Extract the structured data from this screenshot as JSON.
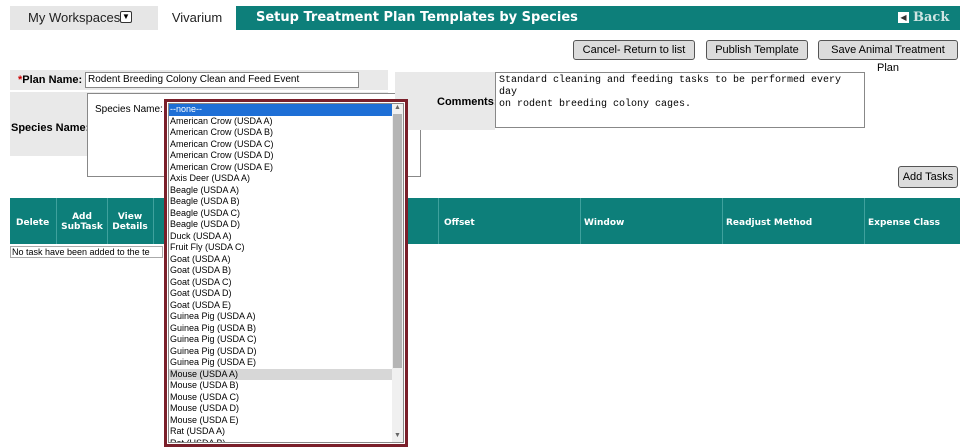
{
  "nav": {
    "workspaces_label": "My Workspaces",
    "vivarium_label": "Vivarium",
    "page_title": "Setup Treatment Plan Templates by Species",
    "back_label": "Back"
  },
  "actions": {
    "cancel": "Cancel- Return to list",
    "publish": "Publish Template",
    "save": "Save Animal Treatment Plan",
    "add_tasks": "Add Tasks"
  },
  "form": {
    "plan_name_required_mark": "*",
    "plan_name_label": "Plan Name:",
    "plan_name_value": "Rodent Breeding Colony Clean and Feed Event",
    "species_section_label": "Species Name:",
    "species_inner_label": "Species Name:",
    "comments_label": "Comments:",
    "comments_value": "Standard cleaning and feeding tasks to be performed every day\non rodent breeding colony cages."
  },
  "table": {
    "headers": {
      "delete": "Delete",
      "add_subtask": "Add\nSubTask",
      "view_details": "View\nDetails",
      "offset": "Offset",
      "window": "Window",
      "readjust": "Readjust Method",
      "expense": "Expense Class"
    },
    "empty_message": "No task have been added to the te"
  },
  "species_dropdown": {
    "selected": "--none--",
    "highlighted": "Mouse (USDA A)",
    "options": [
      "--none--",
      "American Crow (USDA A)",
      "American Crow (USDA B)",
      "American Crow (USDA C)",
      "American Crow (USDA D)",
      "American Crow (USDA E)",
      "Axis Deer (USDA A)",
      "Beagle (USDA A)",
      "Beagle (USDA B)",
      "Beagle (USDA C)",
      "Beagle (USDA D)",
      "Duck (USDA A)",
      "Fruit Fly (USDA C)",
      "Goat (USDA A)",
      "Goat (USDA B)",
      "Goat (USDA C)",
      "Goat (USDA D)",
      "Goat (USDA E)",
      "Guinea Pig (USDA A)",
      "Guinea Pig (USDA B)",
      "Guinea Pig (USDA C)",
      "Guinea Pig (USDA D)",
      "Guinea Pig (USDA E)",
      "Mouse (USDA A)",
      "Mouse (USDA B)",
      "Mouse (USDA C)",
      "Mouse (USDA D)",
      "Mouse (USDA E)",
      "Rat (USDA A)",
      "Rat (USDA B)"
    ]
  },
  "colors": {
    "header_teal": "#0d7f7a",
    "popup_border": "#7a1f2a",
    "selection_blue": "#1e6fd6"
  }
}
